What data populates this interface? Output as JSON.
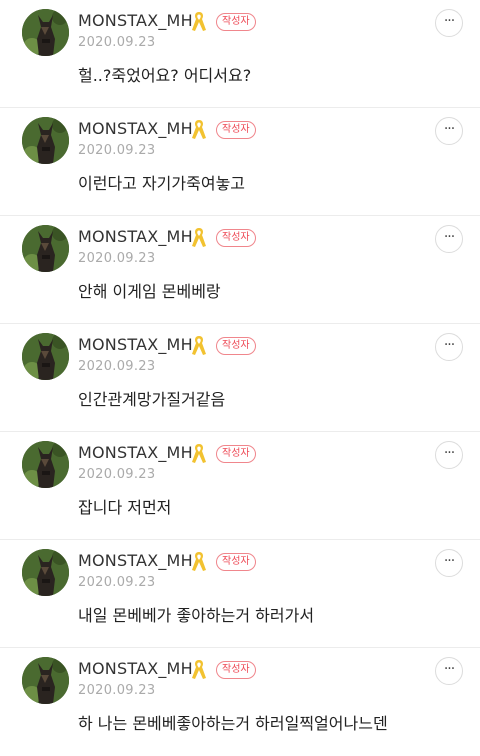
{
  "icons": {
    "ribbon": "yellow-ribbon-icon",
    "more": "more-options-icon",
    "avatar": "profile-avatar"
  },
  "colors": {
    "badge": "#ee4b57",
    "ribbon": "#f2c230"
  },
  "comments": [
    {
      "author": "MONSTAX_MH",
      "badge": "작성자",
      "date": "2020.09.23",
      "text": "헐..?죽었어요? 어디서요?",
      "more": "···"
    },
    {
      "author": "MONSTAX_MH",
      "badge": "작성자",
      "date": "2020.09.23",
      "text": "이런다고 자기가죽여놓고",
      "more": "···"
    },
    {
      "author": "MONSTAX_MH",
      "badge": "작성자",
      "date": "2020.09.23",
      "text": "안해 이게임 몬베베랑",
      "more": "···"
    },
    {
      "author": "MONSTAX_MH",
      "badge": "작성자",
      "date": "2020.09.23",
      "text": "인간관계망가질거같음",
      "more": "···"
    },
    {
      "author": "MONSTAX_MH",
      "badge": "작성자",
      "date": "2020.09.23",
      "text": "잡니다 저먼저",
      "more": "···"
    },
    {
      "author": "MONSTAX_MH",
      "badge": "작성자",
      "date": "2020.09.23",
      "text": "내일 몬베베가 좋아하는거 하러가서",
      "more": "···"
    },
    {
      "author": "MONSTAX_MH",
      "badge": "작성자",
      "date": "2020.09.23",
      "text": "하 나는 몬베베좋아하는거 하러일찍얼어나느덴",
      "more": "···"
    }
  ]
}
